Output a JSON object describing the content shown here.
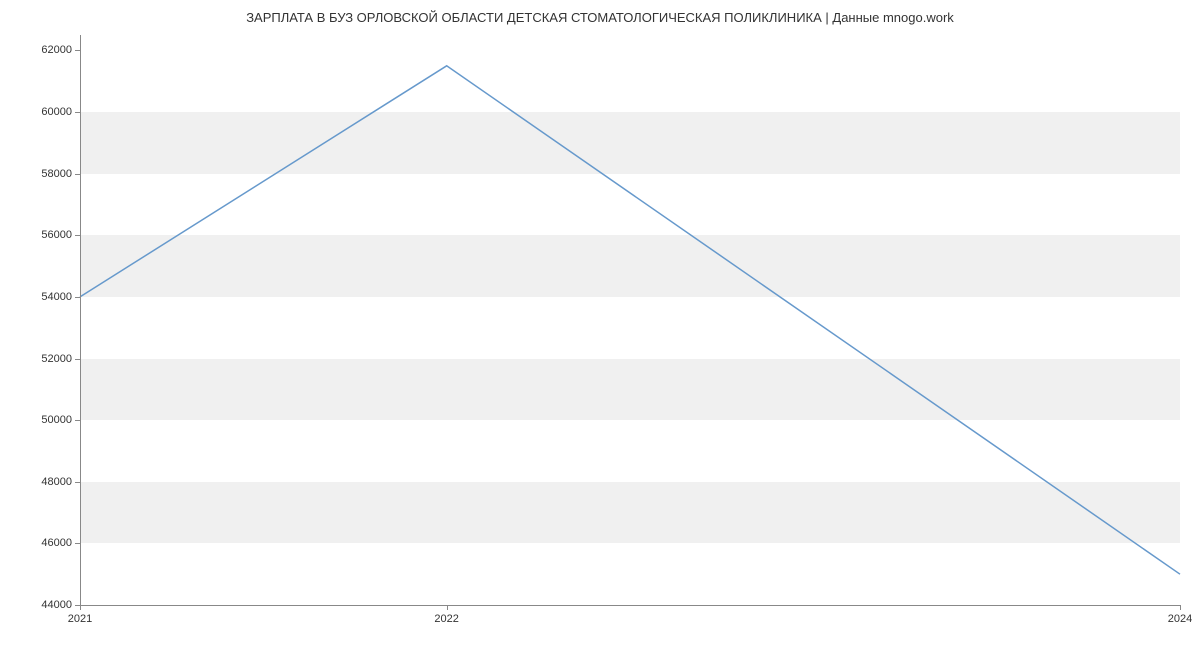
{
  "chart_data": {
    "type": "line",
    "title": "ЗАРПЛАТА В БУЗ ОРЛОВСКОЙ ОБЛАСТИ  ДЕТСКАЯ СТОМАТОЛОГИЧЕСКАЯ ПОЛИКЛИНИКА | Данные mnogo.work",
    "x": [
      2021,
      2022,
      2024
    ],
    "values": [
      54000,
      61500,
      45000
    ],
    "xlabel": "",
    "ylabel": "",
    "x_ticks": [
      2021,
      2022,
      2024
    ],
    "y_ticks": [
      44000,
      46000,
      48000,
      50000,
      52000,
      54000,
      56000,
      58000,
      60000,
      62000
    ],
    "xlim": [
      2021,
      2024
    ],
    "ylim": [
      44000,
      62500
    ],
    "line_color": "#6699cc",
    "grid_band_color": "#f0f0f0"
  }
}
